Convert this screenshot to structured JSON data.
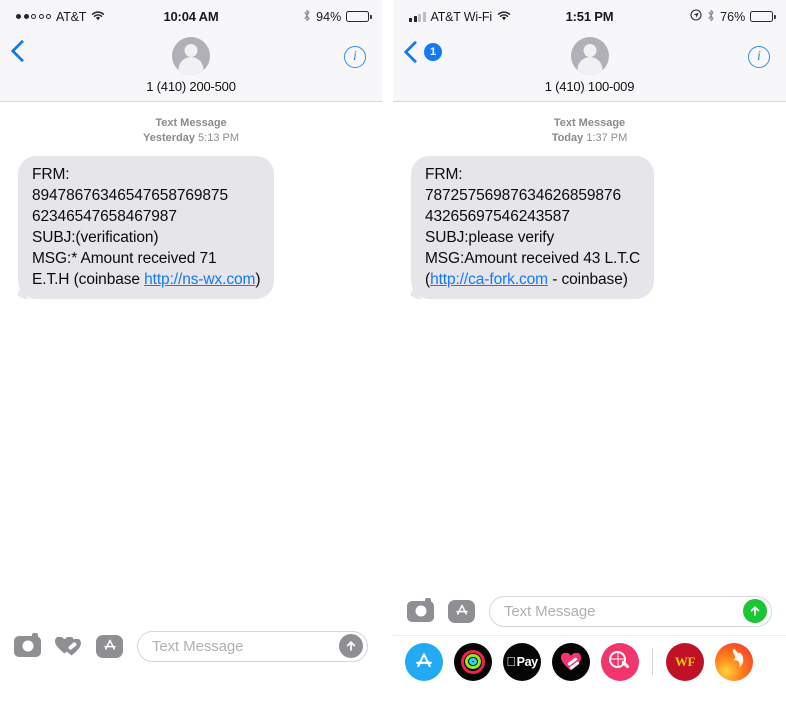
{
  "panels": [
    {
      "id": "left",
      "status_bar": {
        "carrier": "AT&T",
        "signal_dots_filled": 2,
        "signal_dots_total": 5,
        "wifi_icon": "wifi-icon",
        "time": "10:04 AM",
        "bluetooth_icon": "bluetooth-icon",
        "battery_percent": "94%",
        "battery_level": 94
      },
      "nav": {
        "back_icon": "chevron-left-icon",
        "back_badge": "",
        "avatar_icon": "person-avatar-icon",
        "contact_name": "1 (410) 200-500",
        "info_label": "i"
      },
      "thread": {
        "label_type": "Text Message",
        "label_day": "Yesterday",
        "label_time": "5:13 PM",
        "message": {
          "line1": "FRM:",
          "line2": "89478676346547658769875",
          "line3": "62346547658467987",
          "line4": "SUBJ:(verification)",
          "line5": "MSG:* Amount received 71",
          "line6_pre": "E.T.H (coinbase ",
          "link": "http://ns-wx.com",
          "line6_post": ")"
        }
      },
      "toolbar": {
        "camera_icon": "camera-icon",
        "digital_touch_icon": "digital-touch-heart-icon",
        "app_store_icon": "app-store-icon",
        "input_placeholder": "Text Message",
        "input_value": "",
        "send_icon": "send-arrow-up-icon",
        "send_color": "#8e8e93"
      },
      "app_drawer": null
    },
    {
      "id": "right",
      "status_bar": {
        "carrier": "AT&T Wi-Fi",
        "signal_bars_filled": 2,
        "signal_bars_total": 4,
        "wifi_icon": "wifi-icon",
        "time": "1:51 PM",
        "location_icon": "location-arrow-icon",
        "bluetooth_icon": "bluetooth-icon",
        "battery_percent": "76%",
        "battery_level": 76
      },
      "nav": {
        "back_icon": "chevron-left-icon",
        "back_badge": "1",
        "avatar_icon": "person-avatar-icon",
        "contact_name": "1 (410) 100-009",
        "info_label": "i"
      },
      "thread": {
        "label_type": "Text Message",
        "label_day": "Today",
        "label_time": "1:37 PM",
        "message": {
          "line1": "FRM:",
          "line2": "78725756987634626859876",
          "line3": "43265697546243587",
          "line4": "SUBJ:please verify",
          "line5": "MSG:Amount received 43 L.T.C",
          "line6_pre": "(",
          "link": "http://ca-fork.com",
          "line6_post": " - coinbase)"
        }
      },
      "toolbar": {
        "camera_icon": "camera-icon",
        "app_store_icon": "app-store-icon",
        "input_placeholder": "Text Message",
        "input_value": "",
        "send_icon": "send-arrow-up-icon",
        "send_color": "#19c634"
      },
      "app_drawer": {
        "apps": [
          {
            "name": "app-store-app-icon",
            "glyph": "appstore",
            "bg": "#22aaf3",
            "label": ""
          },
          {
            "name": "activity-rings-app-icon",
            "glyph": "rings",
            "bg": "#050505",
            "label": ""
          },
          {
            "name": "apple-pay-app-icon",
            "glyph": "applepay",
            "bg": "#050505",
            "label": "Pay"
          },
          {
            "name": "digital-touch-app-icon",
            "glyph": "dtheart",
            "bg": "#050505",
            "label": ""
          },
          {
            "name": "image-search-app-icon",
            "glyph": "magnifier",
            "bg": "#f2356c",
            "label": ""
          },
          {
            "name": "separator",
            "glyph": "separator",
            "bg": "",
            "label": ""
          },
          {
            "name": "wf-app-icon",
            "glyph": "text",
            "bg": "#c01226",
            "label": "WF"
          },
          {
            "name": "flame-app-icon",
            "glyph": "flame",
            "bg": "#ef2b3f",
            "label": ""
          }
        ]
      }
    }
  ],
  "colors": {
    "bubble_bg": "#e6e5ea",
    "link": "#1579f0",
    "accent_blue": "#1579f0",
    "send_green": "#19c634",
    "chrome_bg": "#f7f7f9",
    "muted_text": "#8e8e93"
  }
}
